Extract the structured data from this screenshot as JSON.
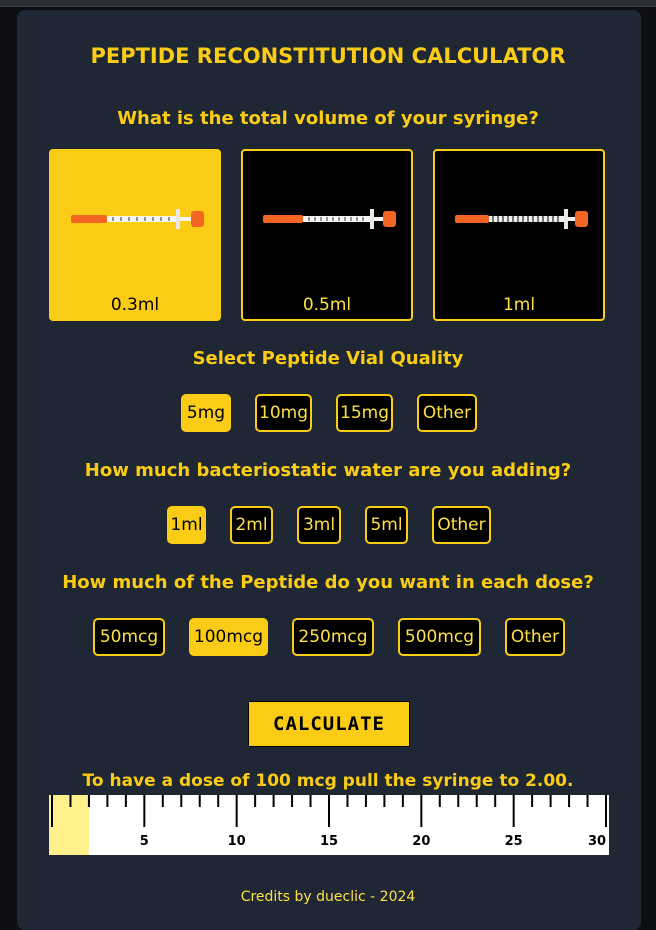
{
  "title": "PEPTIDE RECONSTITUTION CALCULATOR",
  "syringe": {
    "question": "What is the total volume of your syringe?",
    "options": [
      {
        "label": "0.3ml",
        "selected": true
      },
      {
        "label": "0.5ml",
        "selected": false
      },
      {
        "label": "1ml",
        "selected": false
      }
    ]
  },
  "vial": {
    "question": "Select Peptide Vial Quality",
    "options": [
      {
        "label": "5mg",
        "selected": true
      },
      {
        "label": "10mg",
        "selected": false
      },
      {
        "label": "15mg",
        "selected": false
      },
      {
        "label": "Other",
        "selected": false
      }
    ]
  },
  "water": {
    "question": "How much bacteriostatic water are you adding?",
    "options": [
      {
        "label": "1ml",
        "selected": true
      },
      {
        "label": "2ml",
        "selected": false
      },
      {
        "label": "3ml",
        "selected": false
      },
      {
        "label": "5ml",
        "selected": false
      },
      {
        "label": "Other",
        "selected": false
      }
    ]
  },
  "dose": {
    "question": "How much of the Peptide do you want in each dose?",
    "options": [
      {
        "label": "50mcg",
        "selected": false
      },
      {
        "label": "100mcg",
        "selected": true
      },
      {
        "label": "250mcg",
        "selected": false
      },
      {
        "label": "500mcg",
        "selected": false
      },
      {
        "label": "Other",
        "selected": false
      }
    ]
  },
  "calculate_label": "CALCULATE",
  "result_text": "To have a dose of 100 mcg pull the syringe to 2.00.",
  "ruler": {
    "max": 30,
    "major_labels": [
      "5",
      "10",
      "15",
      "20",
      "25",
      "30"
    ],
    "fill_value": 2.0
  },
  "credits": "Credits by dueclic - 2024",
  "colors": {
    "accent": "#facc15",
    "card_bg": "#1f2634",
    "page_bg": "#0d0f13",
    "ruler_fill": "#fef08a"
  }
}
